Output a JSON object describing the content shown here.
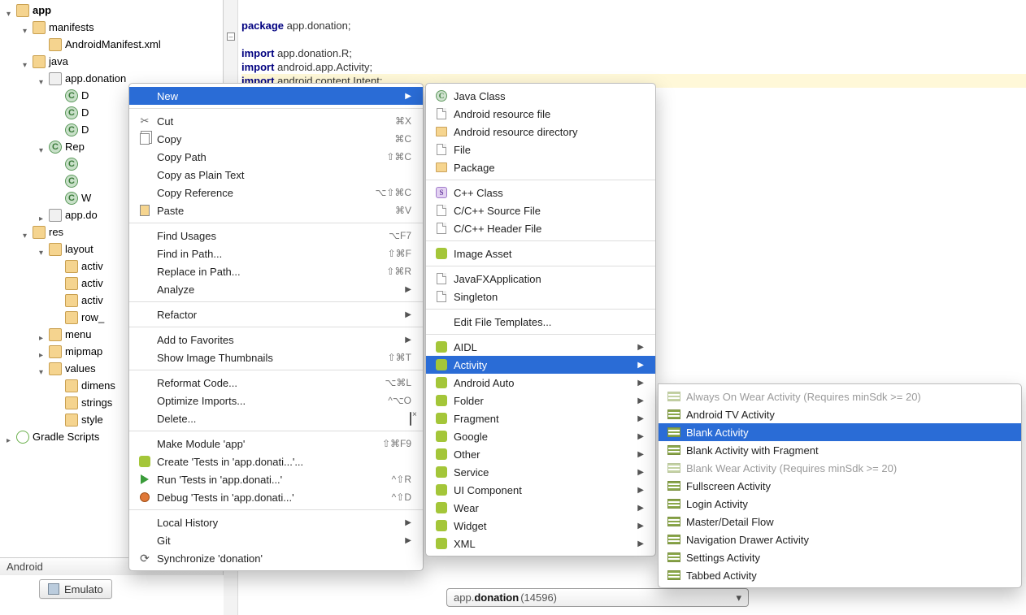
{
  "tree": {
    "app": "app",
    "manifests": "manifests",
    "android_manifest": "AndroidManifest.xml",
    "java": "java",
    "pkg": "app.donation",
    "c_items": [
      "D",
      "D",
      "D",
      "Rep",
      "W"
    ],
    "pkg2": "app.do",
    "res": "res",
    "layout": "layout",
    "lay_items": [
      "activ",
      "activ",
      "activ",
      "row_"
    ],
    "menu": "menu",
    "mipmap": "mipmap",
    "values": "values",
    "val_items": [
      "dimens",
      "strings",
      "style"
    ],
    "gradle": "Gradle Scripts"
  },
  "android_tab": "Android",
  "emulator": "Emulato",
  "code": {
    "l1a": "package",
    "l1b": " app.donation;",
    "l3a": "import",
    "l3b": " app.donation.R;",
    "l4a": "import",
    "l4b": " android.app.Activity;",
    "l5a": "import",
    "l5b": " android.content.Intent;"
  },
  "combo": {
    "a": "app.",
    "b": "donation",
    "c": " (14596)"
  },
  "ctx": {
    "new": "New",
    "cut": "Cut",
    "cut_sc": "⌘X",
    "copy": "Copy",
    "copy_sc": "⌘C",
    "copy_path": "Copy Path",
    "copy_path_sc": "⇧⌘C",
    "copy_plain": "Copy as Plain Text",
    "copy_ref": "Copy Reference",
    "copy_ref_sc": "⌥⇧⌘C",
    "paste": "Paste",
    "paste_sc": "⌘V",
    "find_usages": "Find Usages",
    "find_usages_sc": "⌥F7",
    "find_path": "Find in Path...",
    "find_path_sc": "⇧⌘F",
    "replace_path": "Replace in Path...",
    "replace_path_sc": "⇧⌘R",
    "analyze": "Analyze",
    "refactor": "Refactor",
    "add_fav": "Add to Favorites",
    "show_thumbs": "Show Image Thumbnails",
    "show_thumbs_sc": "⇧⌘T",
    "reformat": "Reformat Code...",
    "reformat_sc": "⌥⌘L",
    "optimize": "Optimize Imports...",
    "optimize_sc": "^⌥O",
    "delete": "Delete...",
    "delete_sc": "⌫",
    "make": "Make Module 'app'",
    "make_sc": "⇧⌘F9",
    "create_tests": "Create 'Tests in 'app.donati...'...",
    "run_tests": "Run 'Tests in 'app.donati...'",
    "run_sc": "^⇧R",
    "debug_tests": "Debug 'Tests in 'app.donati...'",
    "debug_sc": "^⇧D",
    "local_history": "Local History",
    "git": "Git",
    "sync": "Synchronize 'donation'"
  },
  "new_menu": {
    "java_class": "Java Class",
    "and_res_file": "Android resource file",
    "and_res_dir": "Android resource directory",
    "file": "File",
    "package": "Package",
    "cpp_class": "C++ Class",
    "cpp_src": "C/C++ Source File",
    "cpp_hdr": "C/C++ Header File",
    "image_asset": "Image Asset",
    "javafx": "JavaFXApplication",
    "singleton": "Singleton",
    "edit_tpl": "Edit File Templates...",
    "aidl": "AIDL",
    "activity": "Activity",
    "android_auto": "Android Auto",
    "folder": "Folder",
    "fragment": "Fragment",
    "google": "Google",
    "other": "Other",
    "service": "Service",
    "ui_comp": "UI Component",
    "wear": "Wear",
    "widget": "Widget",
    "xml": "XML"
  },
  "activity_menu": {
    "always_wear": "Always On Wear Activity (Requires minSdk >= 20)",
    "android_tv": "Android TV Activity",
    "blank": "Blank Activity",
    "blank_frag": "Blank Activity with Fragment",
    "blank_wear": "Blank Wear Activity (Requires minSdk >= 20)",
    "fullscreen": "Fullscreen Activity",
    "login": "Login Activity",
    "master": "Master/Detail Flow",
    "nav": "Navigation Drawer Activity",
    "settings": "Settings Activity",
    "tabbed": "Tabbed Activity"
  }
}
